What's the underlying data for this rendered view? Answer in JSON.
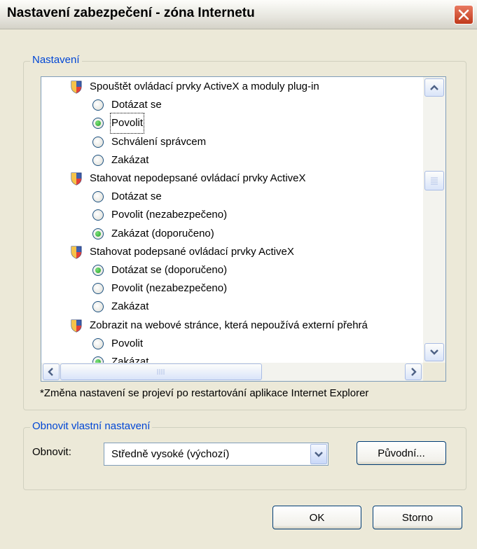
{
  "window": {
    "title": "Nastavení zabezpečení - zóna Internetu"
  },
  "settings_group": {
    "legend": "Nastavení"
  },
  "settings_list": [
    {
      "kind": "header",
      "label": "Spouštět ovládací prvky ActiveX a moduly plug-in"
    },
    {
      "kind": "option",
      "label": "Dotázat se",
      "checked": false
    },
    {
      "kind": "option",
      "label": "Povolit",
      "checked": true,
      "focused": true
    },
    {
      "kind": "option",
      "label": "Schválení správcem",
      "checked": false
    },
    {
      "kind": "option",
      "label": "Zakázat",
      "checked": false
    },
    {
      "kind": "header",
      "label": "Stahovat nepodepsané ovládací prvky ActiveX"
    },
    {
      "kind": "option",
      "label": "Dotázat se",
      "checked": false
    },
    {
      "kind": "option",
      "label": "Povolit (nezabezpečeno)",
      "checked": false
    },
    {
      "kind": "option",
      "label": "Zakázat (doporučeno)",
      "checked": true
    },
    {
      "kind": "header",
      "label": "Stahovat podepsané ovládací prvky ActiveX"
    },
    {
      "kind": "option",
      "label": "Dotázat se (doporučeno)",
      "checked": true
    },
    {
      "kind": "option",
      "label": "Povolit (nezabezpečeno)",
      "checked": false
    },
    {
      "kind": "option",
      "label": "Zakázat",
      "checked": false
    },
    {
      "kind": "header",
      "label": "Zobrazit na webové stránce, která nepoužívá externí přehrá"
    },
    {
      "kind": "option",
      "label": "Povolit",
      "checked": false
    },
    {
      "kind": "option",
      "label": "Zakázat",
      "checked": true
    }
  ],
  "note": "*Změna nastavení se projeví po restartování aplikace Internet Explorer",
  "reset_group": {
    "legend": "Obnovit vlastní nastavení",
    "reset_label": "Obnovit:",
    "reset_value": "Středně vysoké (výchozí)",
    "default_button": "Původní..."
  },
  "buttons": {
    "ok": "OK",
    "cancel": "Storno"
  },
  "colors": {
    "accent": "#0046D5",
    "radio_checked": "#21A121",
    "close": "#C0391B"
  }
}
